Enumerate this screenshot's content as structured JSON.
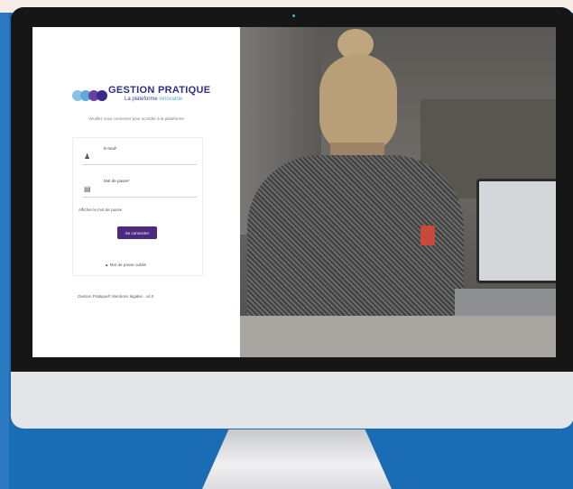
{
  "login": {
    "brand": "GESTION PRATIQUE",
    "tagline_part1": "La plateforme",
    "tagline_accent": "innovante",
    "subtitle": "Veuillez vous connecter pour accéder à la plateforme",
    "email_label": "E-mail*",
    "password_label": "Mot de passe*",
    "show_password_label": "Afficher le mot de passe",
    "submit_label": "Se connecter",
    "forgot_label": "Mot de passe oublié",
    "footer": "Gestion Pratique® Mentions légales · v4.0"
  },
  "icons": {
    "user": "user-icon",
    "lock": "lock-icon",
    "forgot": "lock-icon"
  },
  "colors": {
    "background": "#1a6db5",
    "button": "#4b2a7f",
    "brand": "#2d2f8c",
    "accent": "#5aa9de"
  }
}
